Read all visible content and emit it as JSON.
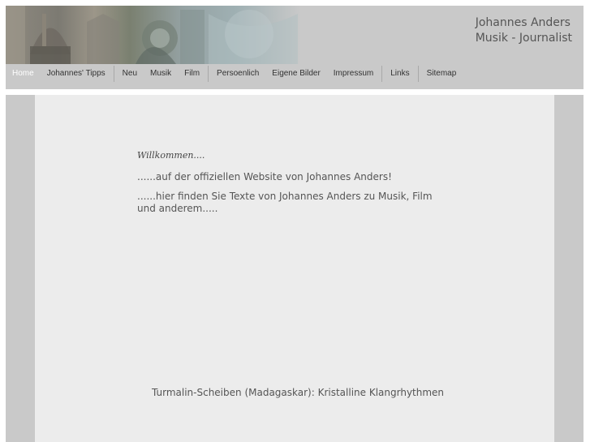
{
  "header": {
    "title_line1": "Johannes Anders",
    "title_line2": "Musik - Journalist"
  },
  "nav": {
    "items": [
      {
        "label": "Home",
        "active": true
      },
      {
        "label": "Johannes' Tipps"
      },
      {
        "label": "Neu"
      },
      {
        "label": "Musik"
      },
      {
        "label": "Film"
      },
      {
        "label": "Persoenlich"
      },
      {
        "label": "Eigene Bilder"
      },
      {
        "label": "Impressum"
      },
      {
        "label": "Links"
      },
      {
        "label": "Sitemap"
      }
    ]
  },
  "main": {
    "welcome": "Willkommen....",
    "line1": "......auf der offiziellen Website von Johannes Anders!",
    "line2": "......hier finden Sie Texte von Johannes Anders zu Musik, Film und anderem.....",
    "caption": "Turmalin-Scheiben (Madagaskar): Kristalline Klangrhythmen"
  },
  "colors": {
    "header_bg": "#c9c9c9",
    "content_bg": "#ececec",
    "text": "#555555"
  }
}
